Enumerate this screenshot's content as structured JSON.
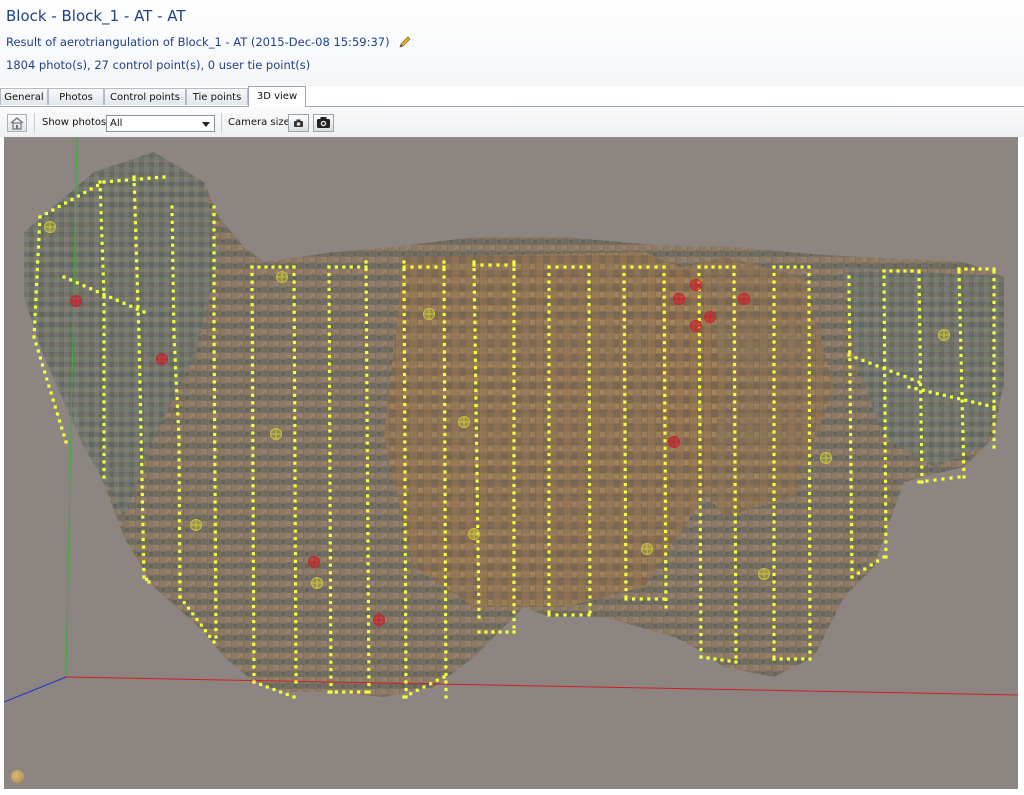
{
  "header": {
    "title": "Block - Block_1 - AT - AT",
    "subtitle": "Result of aerotriangulation of Block_1 - AT (2015-Dec-08 15:59:37)",
    "summary": "1804 photo(s), 27 control point(s), 0 user tie point(s)"
  },
  "tabs": [
    {
      "label": "General"
    },
    {
      "label": "Photos"
    },
    {
      "label": "Control points"
    },
    {
      "label": "Tie points"
    },
    {
      "label": "3D view",
      "active": true
    }
  ],
  "toolbar": {
    "show_photos_label": "Show photos",
    "show_photos_value": "All",
    "camera_size_label": "Camera size"
  },
  "icons": {
    "home": "home-icon",
    "edit": "pencil-icon",
    "camera_small": "camera-small-icon",
    "camera_large": "camera-large-icon"
  },
  "colors": {
    "title_text": "#1f3f8f",
    "viewport_bg": "#8d8581",
    "camera_marker": "#f2ff3a",
    "control_point_red": "#c8242c",
    "control_point_yellow": "#c9c43a",
    "axis_x": "#d0201e",
    "axis_y": "#3cae3a",
    "axis_z": "#2432c8"
  }
}
